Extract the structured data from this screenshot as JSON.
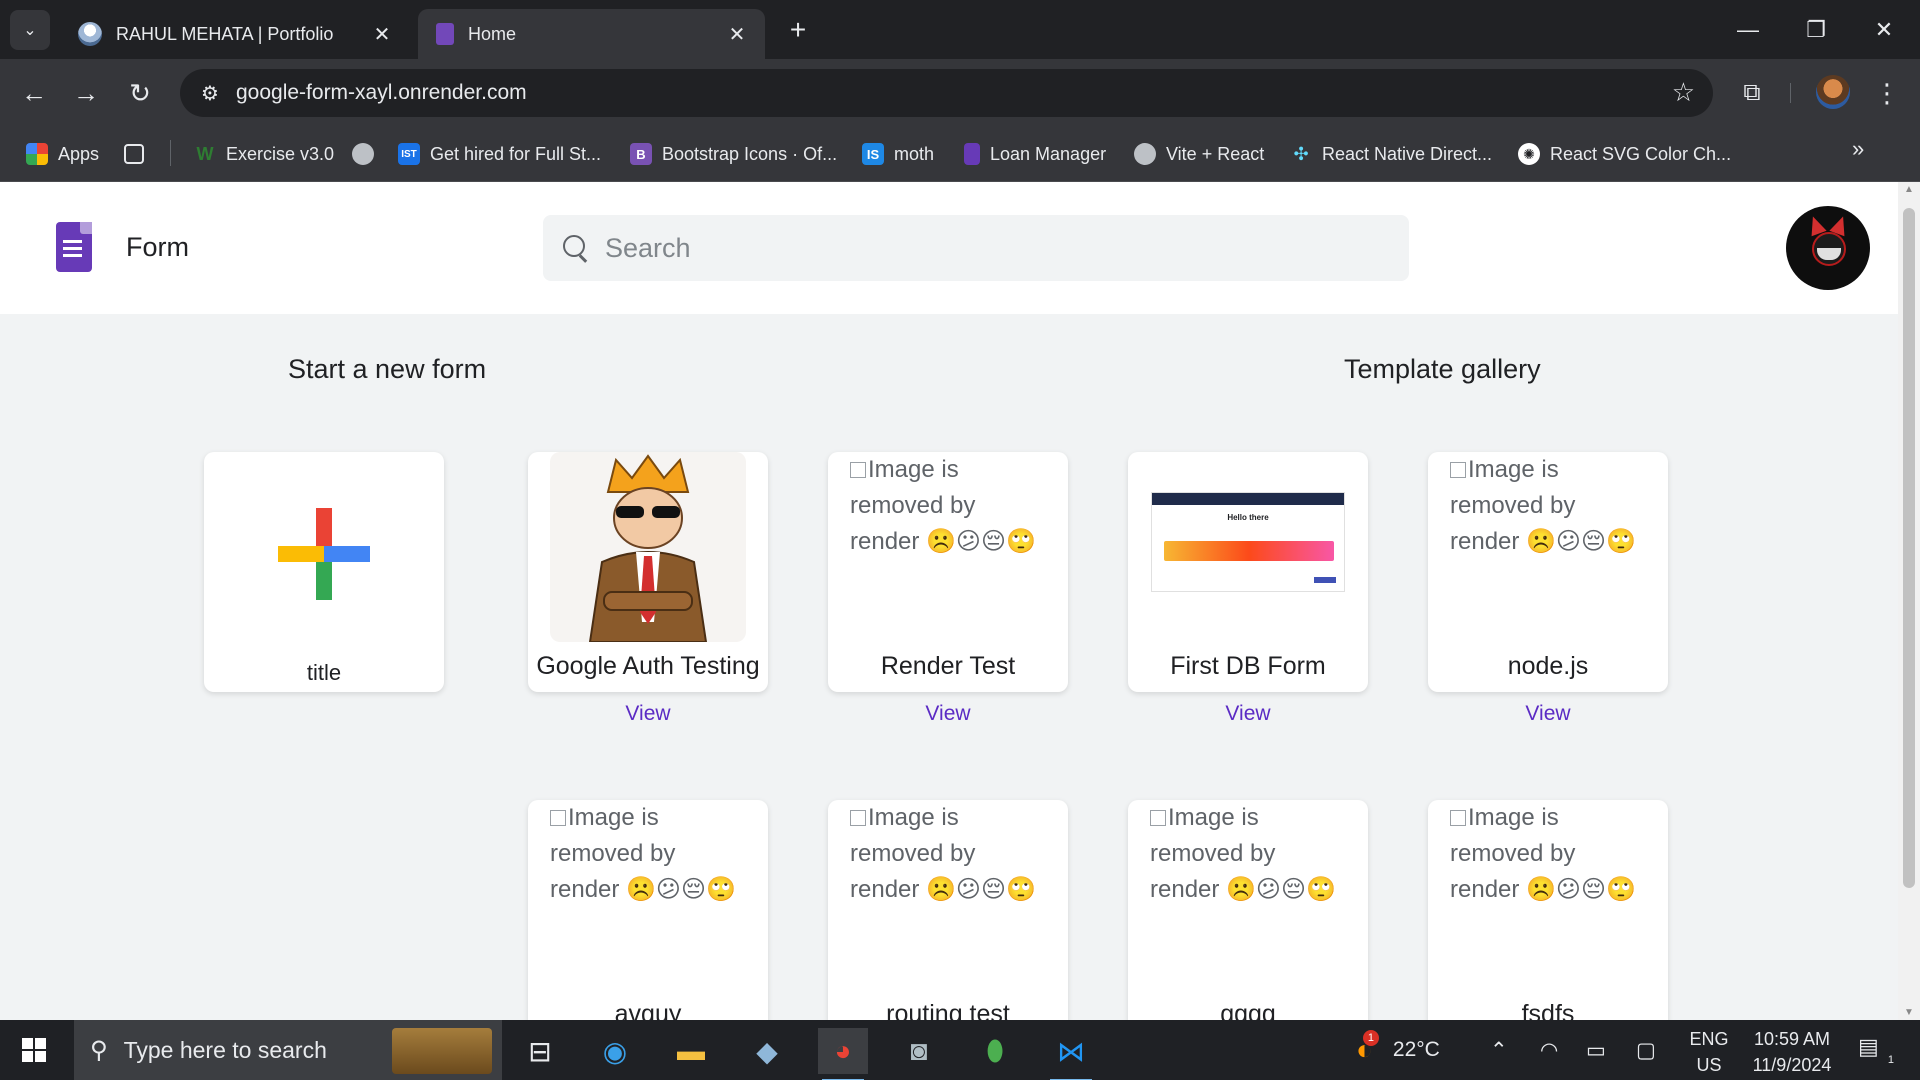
{
  "browser": {
    "tabs": [
      {
        "title": "RAHUL MEHATA | Portfolio",
        "active": false
      },
      {
        "title": "Home",
        "active": true
      }
    ],
    "url": "google-form-xayl.onrender.com",
    "bookmarks": [
      {
        "label": "Apps",
        "icon": "apps-grid-icon"
      },
      {
        "label": "",
        "icon": "tab-groups-icon"
      },
      {
        "label": "Exercise v3.0",
        "icon": "w-logo-icon"
      },
      {
        "label": "",
        "icon": "globe-icon"
      },
      {
        "label": "Get hired for Full St...",
        "icon": "ist-icon"
      },
      {
        "label": "Bootstrap Icons · Of...",
        "icon": "bootstrap-icon"
      },
      {
        "label": "moth",
        "icon": "is-icon"
      },
      {
        "label": "Loan Manager",
        "icon": "forms-icon"
      },
      {
        "label": "Vite + React",
        "icon": "globe-icon"
      },
      {
        "label": "React Native Direct...",
        "icon": "dots-icon"
      },
      {
        "label": "React SVG Color Ch...",
        "icon": "openai-icon"
      }
    ]
  },
  "header": {
    "app_name": "Form",
    "search_placeholder": "Search"
  },
  "sections": {
    "start_new": "Start a new form",
    "template_gallery": "Template gallery"
  },
  "blank_card": {
    "title": "title"
  },
  "broken_image_alt": "Image is removed by render ☹️😕😔🙄",
  "forms": [
    {
      "title": "Google Auth Testing",
      "view": "View",
      "thumb": "cartoon"
    },
    {
      "title": "Render Test",
      "view": "View",
      "thumb": "broken"
    },
    {
      "title": "First DB Form",
      "view": "View",
      "thumb": "db"
    },
    {
      "title": "node.js",
      "view": "View",
      "thumb": "broken"
    },
    {
      "title": "avguy",
      "view": "",
      "thumb": "broken"
    },
    {
      "title": "routing test",
      "view": "",
      "thumb": "broken"
    },
    {
      "title": "gggg",
      "view": "",
      "thumb": "broken"
    },
    {
      "title": "fsdfs",
      "view": "",
      "thumb": "broken"
    }
  ],
  "db_thumb": {
    "heading": "Hello there"
  },
  "taskbar": {
    "search_placeholder": "Type here to search",
    "weather": "22°C",
    "weather_badge": "1",
    "lang_top": "ENG",
    "lang_bottom": "US",
    "time": "10:59 AM",
    "date": "11/9/2024",
    "notifications": "1"
  },
  "colors": {
    "accent": "#673ab7",
    "link": "#5b2bc4",
    "chrome_dark": "#202124",
    "chrome_mid": "#35363a"
  }
}
